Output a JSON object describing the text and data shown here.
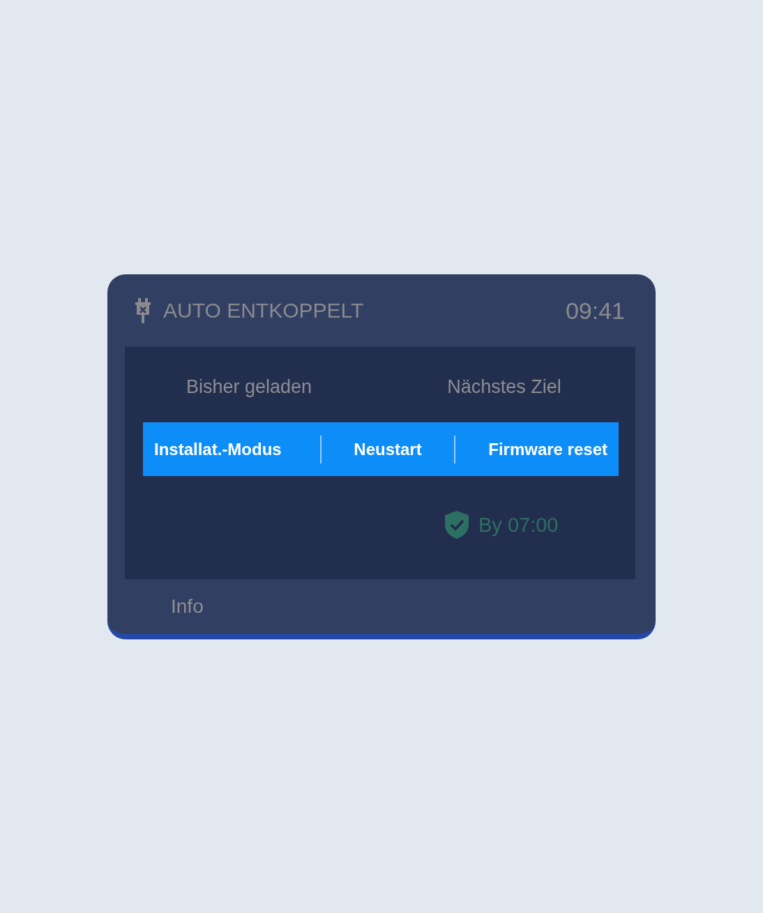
{
  "header": {
    "title": "AUTO ENTKOPPELT",
    "time": "09:41"
  },
  "columns": [
    "Bisher geladen",
    "Nächstes Ziel"
  ],
  "menu": [
    "Installat.-Modus",
    "Neustart",
    "Firmware reset"
  ],
  "target_status": {
    "text": "By 07:00"
  },
  "footer": {
    "label": "Info"
  }
}
